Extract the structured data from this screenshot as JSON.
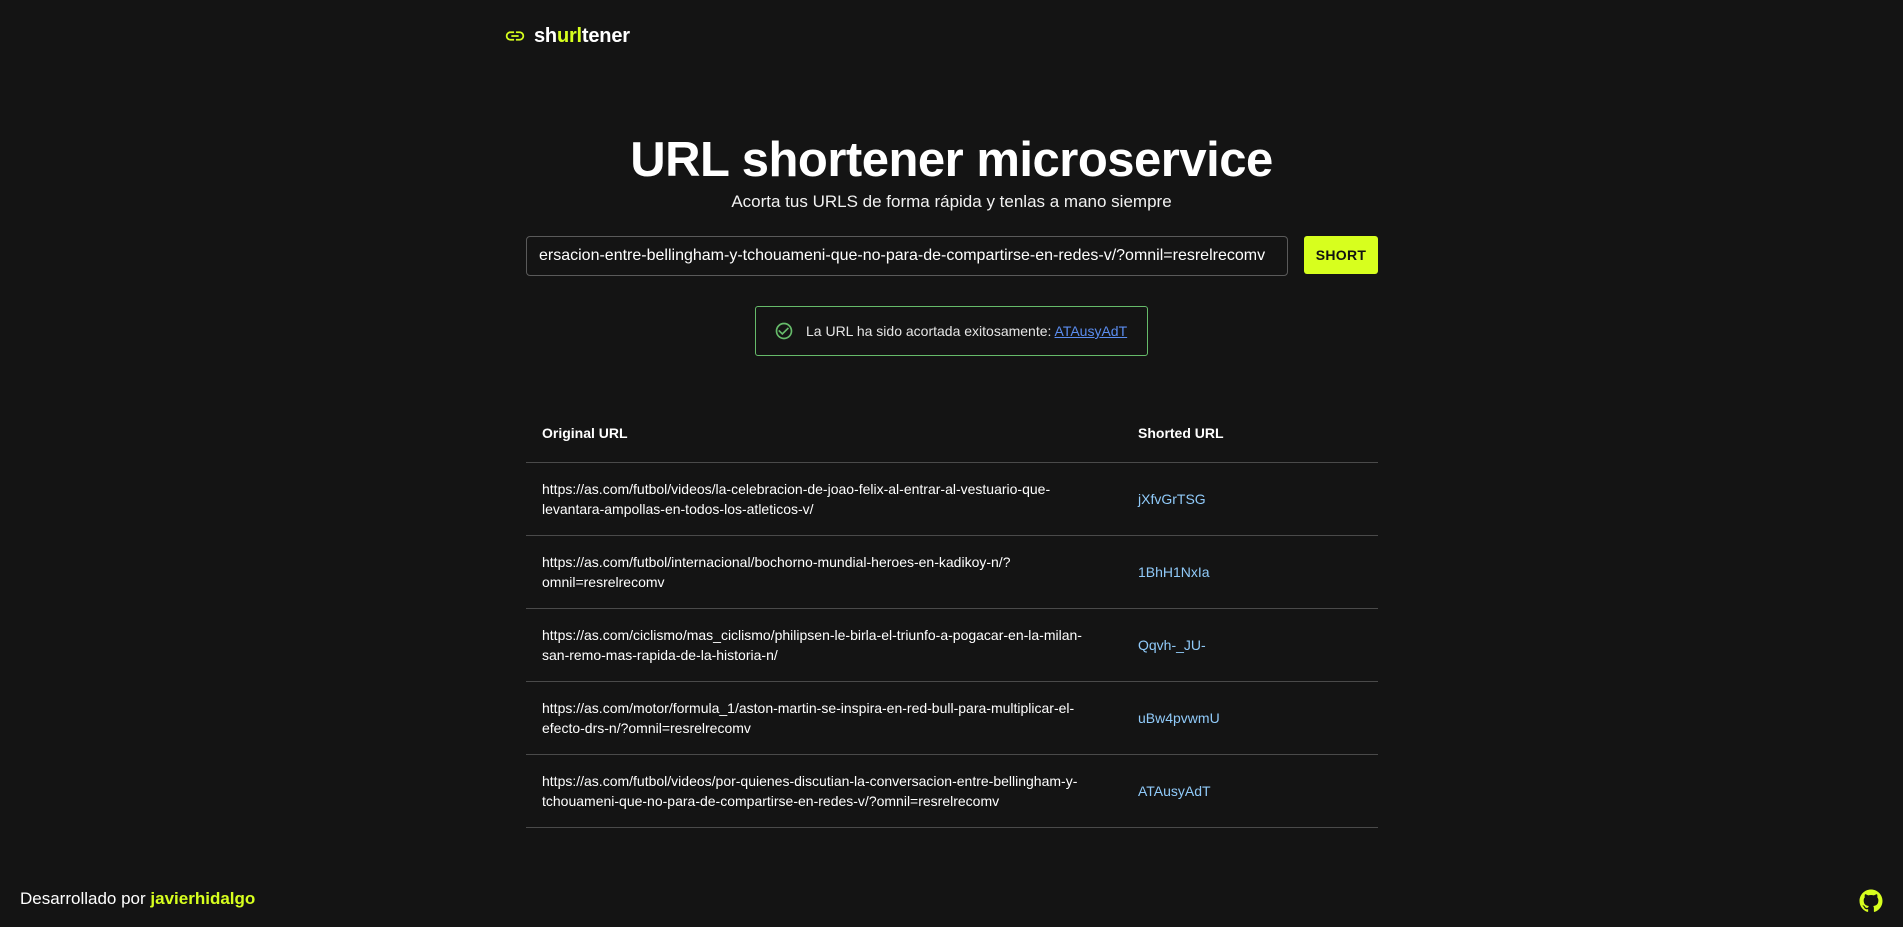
{
  "header": {
    "logo_icon": "link-icon",
    "logo_prefix": "sh",
    "logo_accent": "url",
    "logo_suffix": "tener"
  },
  "hero": {
    "title": "URL shortener microservice",
    "subtitle": "Acorta tus URLS de forma rápida y tenlas a mano siempre"
  },
  "form": {
    "input_value": "ersacion-entre-bellingham-y-tchouameni-que-no-para-de-compartirse-en-redes-v/?omnil=resrelrecomv",
    "button_label": "SHORT"
  },
  "alert": {
    "icon": "check-circle-icon",
    "message": "La URL ha sido acortada exitosamente:",
    "link_text": "ATAusyAdT"
  },
  "table": {
    "headers": [
      "Original URL",
      "Shorted URL"
    ],
    "rows": [
      {
        "original": "https://as.com/futbol/videos/la-celebracion-de-joao-felix-al-entrar-al-vestuario-que-levantara-ampollas-en-todos-los-atleticos-v/",
        "short": "jXfvGrTSG"
      },
      {
        "original": "https://as.com/futbol/internacional/bochorno-mundial-heroes-en-kadikoy-n/?omnil=resrelrecomv",
        "short": "1BhH1NxIa"
      },
      {
        "original": "https://as.com/ciclismo/mas_ciclismo/philipsen-le-birla-el-triunfo-a-pogacar-en-la-milan-san-remo-mas-rapida-de-la-historia-n/",
        "short": "Qqvh-_JU-"
      },
      {
        "original": "https://as.com/motor/formula_1/aston-martin-se-inspira-en-red-bull-para-multiplicar-el-efecto-drs-n/?omnil=resrelrecomv",
        "short": "uBw4pvwmU"
      },
      {
        "original": "https://as.com/futbol/videos/por-quienes-discutian-la-conversacion-entre-bellingham-y-tchouameni-que-no-para-de-compartirse-en-redes-v/?omnil=resrelrecomv",
        "short": "ATAusyAdT"
      }
    ]
  },
  "footer": {
    "credit_prefix": "Desarrollado por",
    "author": "javierhidalgo",
    "github_icon": "github-icon"
  },
  "colors": {
    "background": "#141414",
    "accent": "#d7ff1e",
    "success": "#66bb6a",
    "link": "#90caf9"
  }
}
